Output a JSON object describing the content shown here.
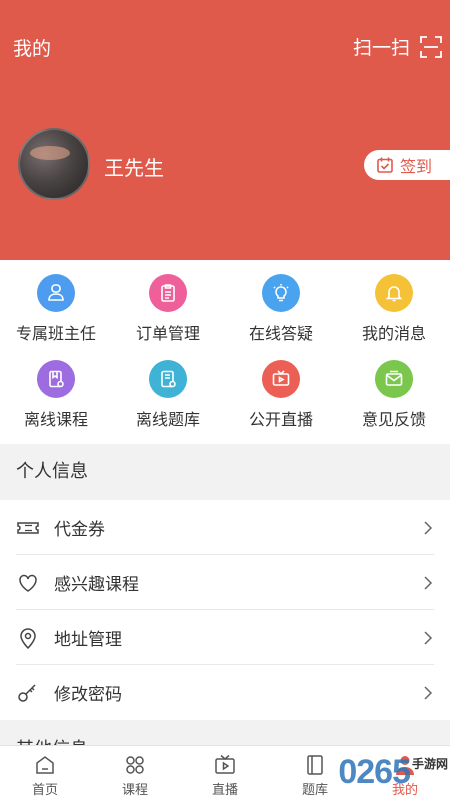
{
  "header": {
    "title": "我的",
    "scan_label": "扫一扫",
    "accent_color": "#e05a4c"
  },
  "profile": {
    "username": "王先生",
    "checkin_label": "签到"
  },
  "grid": [
    {
      "label": "专属班主任",
      "icon": "advisor-icon",
      "color": "#4d9cf0"
    },
    {
      "label": "订单管理",
      "icon": "clipboard-icon",
      "color": "#ef5f9a"
    },
    {
      "label": "在线答疑",
      "icon": "lightbulb-icon",
      "color": "#4aa3ef"
    },
    {
      "label": "我的消息",
      "icon": "bell-icon",
      "color": "#f5c237"
    },
    {
      "label": "离线课程",
      "icon": "download-book-icon",
      "color": "#9c6ce0"
    },
    {
      "label": "离线题库",
      "icon": "download-doc-icon",
      "color": "#3fb3d6"
    },
    {
      "label": "公开直播",
      "icon": "live-tv-icon",
      "color": "#ec5f54"
    },
    {
      "label": "意见反馈",
      "icon": "envelope-icon",
      "color": "#7bc74d"
    }
  ],
  "personal_section": {
    "title": "个人信息",
    "items": [
      {
        "label": "代金券",
        "icon": "coupon-icon"
      },
      {
        "label": "感兴趣课程",
        "icon": "heart-icon"
      },
      {
        "label": "地址管理",
        "icon": "location-pin-icon"
      },
      {
        "label": "修改密码",
        "icon": "key-icon"
      }
    ]
  },
  "other_section": {
    "title": "其他信息"
  },
  "tabbar": [
    {
      "label": "首页",
      "icon": "home-icon"
    },
    {
      "label": "课程",
      "icon": "grid-icon"
    },
    {
      "label": "直播",
      "icon": "tv-icon"
    },
    {
      "label": "题库",
      "icon": "book-icon"
    },
    {
      "label": "我的",
      "icon": "user-icon",
      "active": true
    }
  ],
  "watermark": {
    "number": "0265",
    "text": "手游网"
  }
}
